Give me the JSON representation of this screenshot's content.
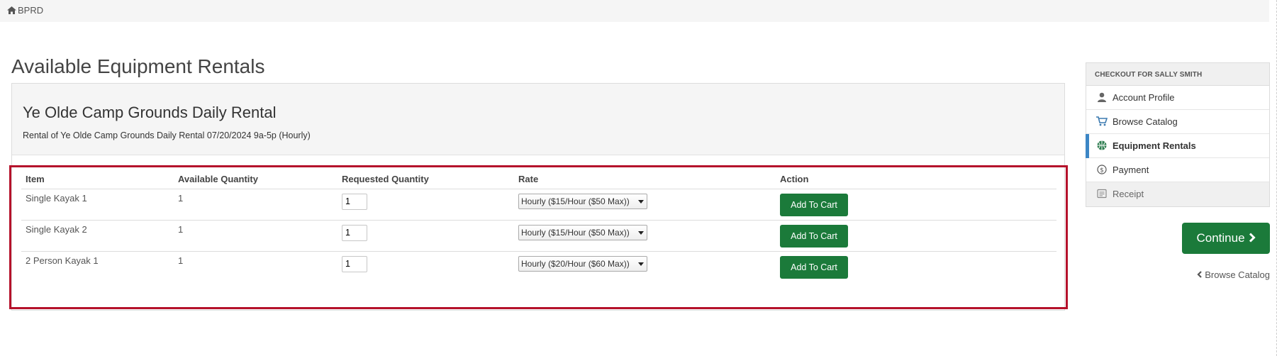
{
  "breadcrumb": {
    "home_label": "BPRD"
  },
  "page": {
    "title": "Available Equipment Rentals"
  },
  "rental": {
    "name": "Ye Olde Camp Grounds Daily Rental",
    "description": "Rental of Ye Olde Camp Grounds Daily Rental 07/20/2024 9a-5p (Hourly)"
  },
  "table": {
    "columns": {
      "item": "Item",
      "available": "Available Quantity",
      "requested": "Requested Quantity",
      "rate": "Rate",
      "action": "Action"
    },
    "rows": [
      {
        "item": "Single Kayak 1",
        "available": "1",
        "requested": "1",
        "rate": "Hourly ($15/Hour ($50 Max))",
        "action_label": "Add To Cart"
      },
      {
        "item": "Single Kayak 2",
        "available": "1",
        "requested": "1",
        "rate": "Hourly ($15/Hour ($50 Max))",
        "action_label": "Add To Cart"
      },
      {
        "item": "2 Person Kayak 1",
        "available": "1",
        "requested": "1",
        "rate": "Hourly ($20/Hour ($60 Max))",
        "action_label": "Add To Cart"
      }
    ]
  },
  "sidebar": {
    "header": "CHECKOUT FOR SALLY SMITH",
    "items": [
      {
        "label": "Account Profile",
        "icon": "user-icon"
      },
      {
        "label": "Browse Catalog",
        "icon": "cart-icon"
      },
      {
        "label": "Equipment Rentals",
        "icon": "basketball-icon",
        "state": "active"
      },
      {
        "label": "Payment",
        "icon": "dollar-circle-icon"
      },
      {
        "label": "Receipt",
        "icon": "receipt-icon",
        "state": "disabled"
      }
    ]
  },
  "actions": {
    "continue_label": "Continue",
    "browse_catalog_label": "Browse Catalog"
  },
  "colors": {
    "primary_green": "#1b7a3a",
    "highlight_red": "#b5122b",
    "active_blue": "#3c86c5"
  }
}
